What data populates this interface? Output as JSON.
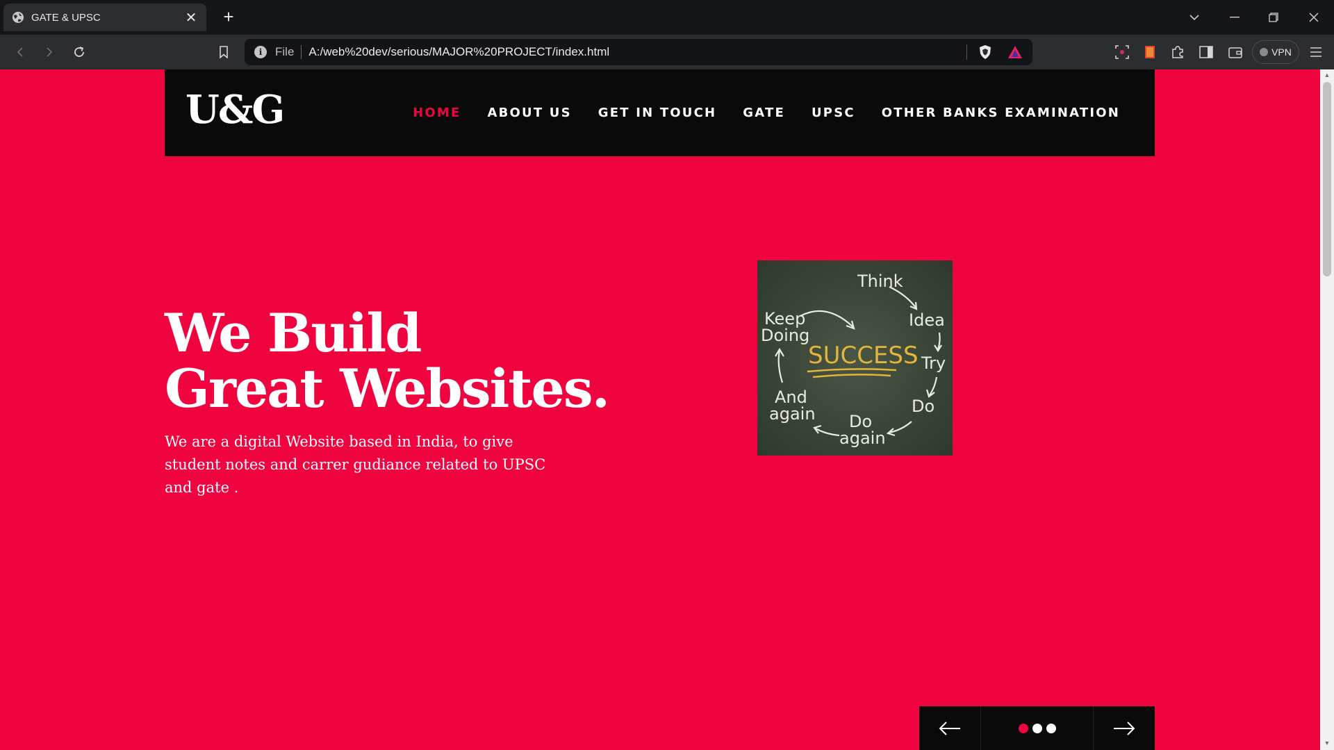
{
  "browser": {
    "tab_title": "GATE & UPSC",
    "tab_close": "✕",
    "new_tab": "+",
    "url_scheme": "File",
    "url": "A:/web%20dev/serious/MAJOR%20PROJECT/index.html",
    "vpn_label": "VPN"
  },
  "site": {
    "logo": "U&G",
    "nav": [
      {
        "label": "HOME",
        "active": true
      },
      {
        "label": "ABOUT US",
        "active": false
      },
      {
        "label": "GET IN TOUCH",
        "active": false
      },
      {
        "label": "GATE",
        "active": false
      },
      {
        "label": "UPSC",
        "active": false
      },
      {
        "label": "OTHER BANKS EXAMINATION",
        "active": false
      }
    ],
    "hero": {
      "title_line1": "We Build",
      "title_line2": "Great Websites.",
      "description": "We are a digital Website based in India, to give student notes and carrer gudiance related to UPSC and gate ."
    },
    "image": {
      "center_word": "SUCCESS",
      "words": [
        "Think",
        "Idea",
        "Try",
        "Do",
        "Do",
        "again",
        "And",
        "again",
        "Keep",
        "Doing"
      ]
    },
    "slider": {
      "slide_count": 3,
      "active_slide": 1
    },
    "colors": {
      "accent": "#f0043f",
      "nav_bg": "#0a0a0a",
      "chalkboard": "#3b4537",
      "success_text": "#e3b53a"
    }
  }
}
